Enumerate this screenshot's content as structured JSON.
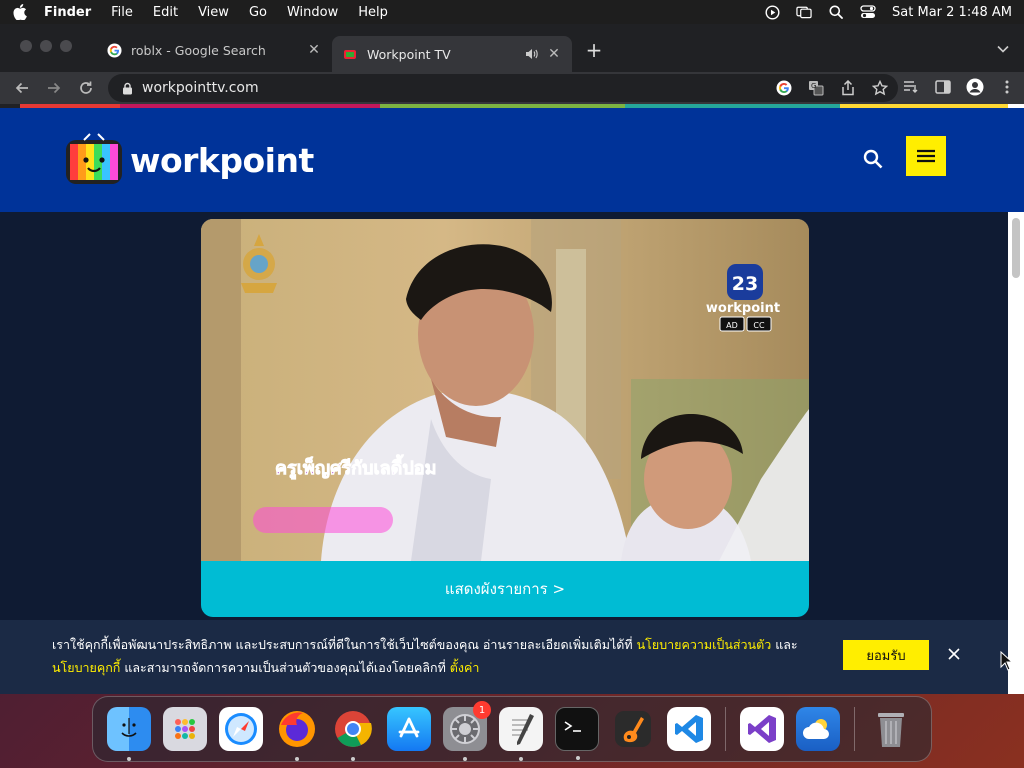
{
  "menubar": {
    "app": "Finder",
    "items": [
      "File",
      "Edit",
      "View",
      "Go",
      "Window",
      "Help"
    ],
    "datetime": "Sat Mar 2  1:48 AM",
    "status_icons": [
      "play-circle-icon",
      "screen-mirror-icon",
      "spotlight-search-icon",
      "control-center-icon"
    ]
  },
  "browser": {
    "tabs": [
      {
        "title": "roblx - Google Search",
        "favicon": "google-icon"
      },
      {
        "title": "Workpoint TV",
        "favicon": "workpoint-icon",
        "audio": true
      }
    ],
    "url": "workpointtv.com"
  },
  "site": {
    "logo_text": "workpoint",
    "player": {
      "channel_number": "23",
      "channel_name": "workpoint",
      "badges": [
        "AD",
        "CC"
      ],
      "show_overlay": "ครูเพ็ญศรีกับเลดี้ปอม"
    },
    "schedule_button": "แสดงผังรายการ >"
  },
  "cookie_banner": {
    "text_1": "เราใช้คุกกี้เพื่อพัฒนาประสิทธิภาพ และประสบการณ์ที่ดีในการใช้เว็บไซต์ของคุณ อ่านรายละเอียดเพิ่มเติมได้ที่ ",
    "link_privacy": "นโยบายความเป็นส่วนตัว",
    "text_and": " และ",
    "link_cookie": "นโยบายคุกกี้",
    "text_2": " และสามารถจัดการความเป็นส่วนตัวของคุณได้เองโดยคลิกที่ ",
    "link_settings": "ตั้งค่า",
    "accept_label": "ยอมรับ"
  },
  "dock": {
    "badge_count": "1",
    "apps": [
      "finder-icon",
      "launchpad-icon",
      "safari-icon",
      "firefox-icon",
      "chrome-icon",
      "app-store-icon",
      "system-preferences-icon",
      "textedit-icon",
      "terminal-icon",
      "garageband-icon",
      "vscode-icon",
      "visual-studio-icon",
      "weather-icon",
      "trash-icon"
    ]
  },
  "colors": {
    "site_header": "#003399",
    "page_bg": "#0f1b33",
    "accent_yellow": "#ffee00",
    "schedule_cyan": "#00bcd4"
  }
}
